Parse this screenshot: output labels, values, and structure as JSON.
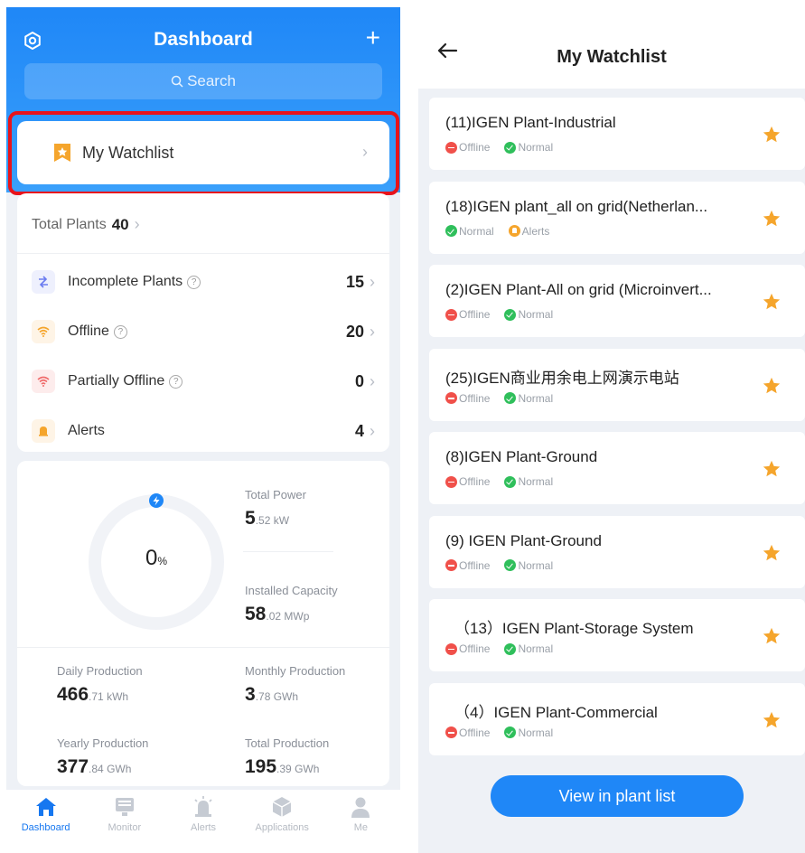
{
  "dashboard": {
    "title": "Dashboard",
    "search_placeholder": "Search",
    "watchlist_label": "My Watchlist",
    "total_plants_label": "Total Plants",
    "total_plants_value": "40",
    "status_rows": [
      {
        "label": "Incomplete Plants",
        "value": "15",
        "color": "#6b7cf0"
      },
      {
        "label": "Offline",
        "value": "20",
        "color": "#f5a52c"
      },
      {
        "label": "Partially Offline",
        "value": "0",
        "color": "#f06b6b"
      },
      {
        "label": "Alerts",
        "value": "4",
        "color": "#f5a52c"
      }
    ],
    "gauge": {
      "value": "0",
      "unit": "%"
    },
    "total_power": {
      "label": "Total Power",
      "value": "5",
      "decimal": ".52",
      "unit": "kW"
    },
    "installed_capacity": {
      "label": "Installed Capacity",
      "value": "58",
      "decimal": ".02",
      "unit": "MWp"
    },
    "daily_production": {
      "label": "Daily Production",
      "value": "466",
      "decimal": ".71",
      "unit": "kWh"
    },
    "monthly_production": {
      "label": "Monthly Production",
      "value": "3",
      "decimal": ".78",
      "unit": "GWh"
    },
    "yearly_production": {
      "label": "Yearly Production",
      "value": "377",
      "decimal": ".84",
      "unit": "GWh"
    },
    "total_production": {
      "label": "Total Production",
      "value": "195",
      "decimal": ".39",
      "unit": "GWh"
    },
    "tabs": [
      {
        "label": "Dashboard",
        "icon": "home-icon",
        "active": true
      },
      {
        "label": "Monitor",
        "icon": "monitor-icon",
        "active": false
      },
      {
        "label": "Alerts",
        "icon": "alarm-icon",
        "active": false
      },
      {
        "label": "Applications",
        "icon": "cube-icon",
        "active": false
      },
      {
        "label": "Me",
        "icon": "user-icon",
        "active": false
      }
    ],
    "colors": {
      "header": "#1f87f7",
      "highlight": "#e8131b",
      "accent": "#1677f0"
    }
  },
  "watchlist": {
    "title": "My Watchlist",
    "button_label": "View in plant list",
    "plants": [
      {
        "name": "(11)IGEN Plant-Industrial",
        "status1": "Offline",
        "status1_type": "red",
        "status2": "Normal",
        "status2_type": "green"
      },
      {
        "name": "(18)IGEN plant_all on grid(Netherlan...",
        "status1": "Normal",
        "status1_type": "green",
        "status2": "Alerts",
        "status2_type": "orange"
      },
      {
        "name": "(2)IGEN Plant-All on grid (Microinvert...",
        "status1": "Offline",
        "status1_type": "red",
        "status2": "Normal",
        "status2_type": "green"
      },
      {
        "name": "(25)IGEN商业用余电上网演示电站",
        "status1": "Offline",
        "status1_type": "red",
        "status2": "Normal",
        "status2_type": "green"
      },
      {
        "name": "(8)IGEN Plant-Ground",
        "status1": "Offline",
        "status1_type": "red",
        "status2": "Normal",
        "status2_type": "green"
      },
      {
        "name": "(9) IGEN Plant-Ground",
        "status1": "Offline",
        "status1_type": "red",
        "status2": "Normal",
        "status2_type": "green"
      },
      {
        "name": "（13）IGEN Plant-Storage System",
        "status1": "Offline",
        "status1_type": "red",
        "status2": "Normal",
        "status2_type": "green"
      },
      {
        "name": "（4）IGEN Plant-Commercial",
        "status1": "Offline",
        "status1_type": "red",
        "status2": "Normal",
        "status2_type": "green"
      }
    ],
    "star_color": "#f5a52c"
  }
}
